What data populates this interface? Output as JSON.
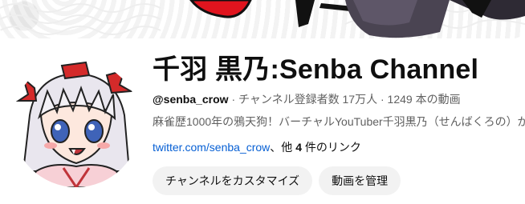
{
  "channel": {
    "title": "千羽 黒乃:Senba Channel",
    "handle": "@senba_crow",
    "subscribers": "チャンネル登録者数 17万人",
    "videos": "1249 本の動画",
    "separator": "·",
    "description": "麻雀歴1000年の鴉天狗！バーチャルYouTuber千羽黒乃（せんばくろの）が",
    "link_text": "twitter.com/senba_crow",
    "more_links_prefix": "、他 ",
    "more_links_count": "4",
    "more_links_suffix": " 件のリンク"
  },
  "buttons": {
    "customize": "チャンネルをカスタマイズ",
    "manage": "動画を管理"
  },
  "colors": {
    "link": "#065fd4",
    "button_bg": "#f2f2f2",
    "secondary_text": "#606060"
  }
}
